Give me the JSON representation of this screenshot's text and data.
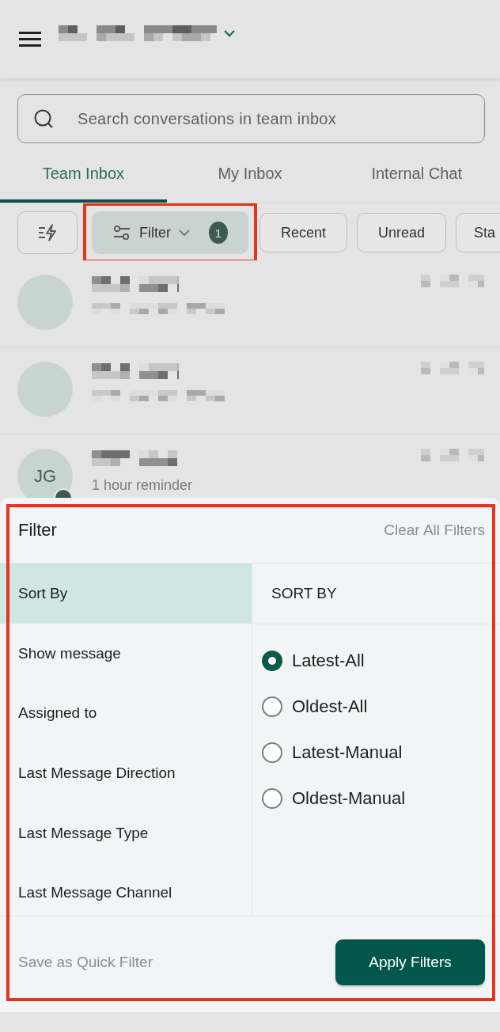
{
  "search": {
    "placeholder": "Search conversations in team inbox"
  },
  "tabs": [
    {
      "label": "Team Inbox",
      "selected": true
    },
    {
      "label": "My Inbox",
      "selected": false
    },
    {
      "label": "Internal Chat",
      "selected": false
    }
  ],
  "chips": [
    {
      "kind": "quick"
    },
    {
      "kind": "filter",
      "label": "Filter",
      "count": "1",
      "highlighted": true
    },
    {
      "kind": "plain",
      "label": "Recent"
    },
    {
      "kind": "plain",
      "label": "Unread"
    },
    {
      "kind": "plain",
      "label": "Sta"
    }
  ],
  "conversations": [
    {
      "kind": "redacted"
    },
    {
      "kind": "redacted"
    },
    {
      "kind": "visible",
      "initials": "JG",
      "preview": "1 hour reminder"
    }
  ],
  "filter_sheet": {
    "title": "Filter",
    "clear": "Clear All Filters",
    "highlighted": true,
    "categories": [
      {
        "label": "Sort By",
        "selected": true
      },
      {
        "label": "Show message",
        "selected": false
      },
      {
        "label": "Assigned to",
        "selected": false
      },
      {
        "label": "Last Message Direction",
        "selected": false
      },
      {
        "label": "Last Message Type",
        "selected": false
      },
      {
        "label": "Last Message Channel",
        "selected": false
      }
    ],
    "section_title": "SORT BY",
    "options": [
      {
        "label": "Latest-All",
        "selected": true
      },
      {
        "label": "Oldest-All",
        "selected": false
      },
      {
        "label": "Latest-Manual",
        "selected": false
      },
      {
        "label": "Oldest-Manual",
        "selected": false
      }
    ],
    "save": "Save as Quick Filter",
    "apply": "Apply Filters"
  }
}
